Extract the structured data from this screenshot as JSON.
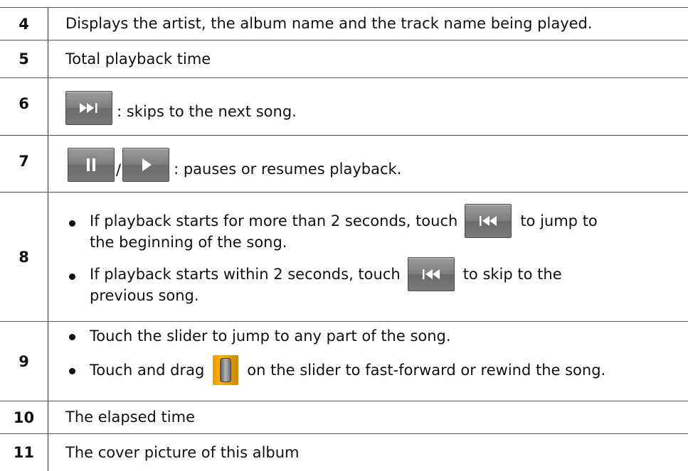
{
  "rows": [
    {
      "num": "4",
      "text": "Displays the artist, the album name and the track name being played."
    },
    {
      "num": "5",
      "text": "Total playback time"
    },
    {
      "num": "6",
      "icon": "next-track-button-icon",
      "text": ": skips to the next song."
    },
    {
      "num": "7",
      "icons": [
        "pause-button-icon",
        "play-button-icon"
      ],
      "separator": "/",
      "text": ": pauses or resumes playback."
    },
    {
      "num": "8",
      "bullets": [
        {
          "before": "If playback starts for more than 2 seconds, touch",
          "icon": "previous-track-button-icon",
          "after": "to jump to",
          "continuation": "the beginning of the song."
        },
        {
          "before": "If playback starts within 2 seconds, touch",
          "icon": "previous-track-button-icon",
          "after": "to skip to the",
          "continuation": "previous song."
        }
      ]
    },
    {
      "num": "9",
      "bullets": [
        {
          "text": "Touch the slider to jump to any part of the song."
        },
        {
          "before": "Touch and drag",
          "icon": "slider-thumb-icon",
          "after": "on the slider to fast-forward or rewind the song."
        }
      ]
    },
    {
      "num": "10",
      "text": "The elapsed time"
    },
    {
      "num": "11",
      "text": "The cover picture of this album"
    }
  ]
}
